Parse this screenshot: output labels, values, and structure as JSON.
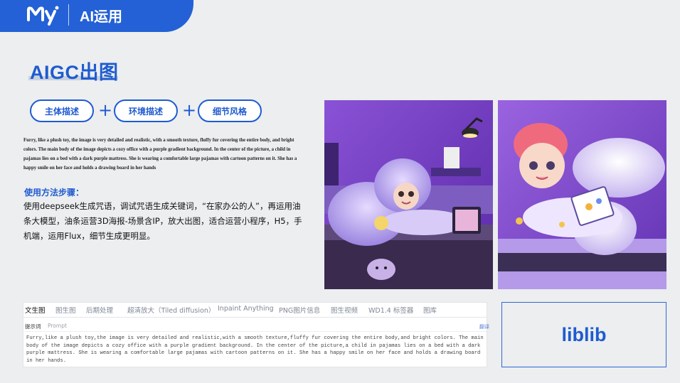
{
  "header": {
    "title": "AI运用",
    "brand_color": "#2461d6"
  },
  "page": {
    "title": "AIGC出图"
  },
  "formula": {
    "items": [
      "主体描述",
      "环境描述",
      "细节风格"
    ],
    "plus": "+"
  },
  "prompt_en": "Furry, like a plush toy, the image is very detailed and realistic, with a smooth texture, fluffy fur covering the entire body, and bright colors. The main body of the image depicts a cozy office with a purple gradient background. In the center of the picture, a child in pajamas lies on a bed with a dark purple mattress. She is wearing a comfortable large pajamas with cartoon patterns on it. She has a happy smile on her face and holds a drawing board in her hands",
  "steps": {
    "heading": "使用方法步骤：",
    "body": "使用deepseek生成咒语，调试咒语生成关键词，“在家办公的人”，再运用油条大模型，油条运营3D海报-场景含IP，放大出图，适合运营小程序，H5，手机端，运用Flux，细节生成更明显。"
  },
  "sd_panel": {
    "tabs": [
      "文生图",
      "图生图",
      "后期处理",
      "超清放大（Tiled diffusion）",
      "Inpaint Anything",
      "PNG图片信息",
      "图生视频",
      "WD1.4 标签器",
      "图库"
    ],
    "active_tab": "文生图",
    "prompt_label": "提示词",
    "prompt_label_en": "Prompt",
    "translate_link": "翻译",
    "prompt_text": "Furry,like a plush toy,the image is very detailed and realistic,with a smooth texture,fluffy fur covering the entire body,and bright colors. The main body of the image depicts a cozy office with a purple gradient background. In the center of the picture,a child in pajamas lies on a bed with a dark purple mattress. She is wearing a comfortable large pajamas with cartoon patterns on it. She has a happy smile on her face and holds a drawing board in her hands."
  },
  "brand_box": {
    "label": "liblib"
  },
  "colors": {
    "accent": "#1f5bd0",
    "purple": "#8f6ad8",
    "bg": "#eceeef"
  }
}
